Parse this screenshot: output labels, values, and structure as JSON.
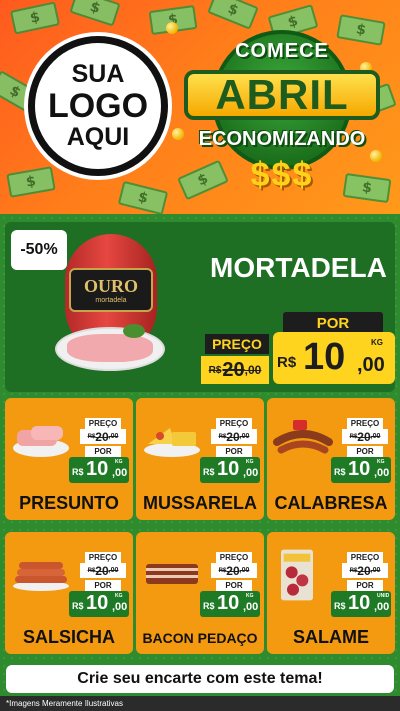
{
  "header": {
    "logo": {
      "line1": "SUA",
      "line2": "LOGO",
      "line3": "AQUI"
    },
    "badge": {
      "top": "COMECE",
      "main": "ABRIL",
      "bottom": "ECONOMIZANDO",
      "symbols": "$$$"
    }
  },
  "hero": {
    "discount": "-50%",
    "product": "MORTADELA",
    "brand": "OURO",
    "brand_sub": "mortadela",
    "preco_label": "PREÇO",
    "old_currency": "R$",
    "old_int": "20",
    "old_cents": ",00",
    "por_label": "POR",
    "new_currency": "R$",
    "new_int": "10",
    "new_cents": ",00",
    "unit": "KG"
  },
  "cards": [
    {
      "name": "PRESUNTO",
      "preco_label": "PREÇO",
      "old_currency": "R$",
      "old_int": "20",
      "old_cents": ",00",
      "por_label": "POR",
      "new_currency": "R$",
      "new_int": "10",
      "new_cents": ",00",
      "unit": "KG"
    },
    {
      "name": "MUSSARELA",
      "preco_label": "PREÇO",
      "old_currency": "R$",
      "old_int": "20",
      "old_cents": ",00",
      "por_label": "POR",
      "new_currency": "R$",
      "new_int": "10",
      "new_cents": ",00",
      "unit": "KG"
    },
    {
      "name": "CALABRESA",
      "preco_label": "PREÇO",
      "old_currency": "R$",
      "old_int": "20",
      "old_cents": ",00",
      "por_label": "POR",
      "new_currency": "R$",
      "new_int": "10",
      "new_cents": ",00",
      "unit": "KG"
    },
    {
      "name": "SALSICHA",
      "preco_label": "PREÇO",
      "old_currency": "R$",
      "old_int": "20",
      "old_cents": ",00",
      "por_label": "POR",
      "new_currency": "R$",
      "new_int": "10",
      "new_cents": ",00",
      "unit": "KG"
    },
    {
      "name": "BACON PEDAÇO",
      "preco_label": "PREÇO",
      "old_currency": "R$",
      "old_int": "20",
      "old_cents": ",00",
      "por_label": "POR",
      "new_currency": "R$",
      "new_int": "10",
      "new_cents": ",00",
      "unit": "KG"
    },
    {
      "name": "SALAME",
      "preco_label": "PREÇO",
      "old_currency": "R$",
      "old_int": "20",
      "old_cents": ",00",
      "por_label": "POR",
      "new_currency": "R$",
      "new_int": "10",
      "new_cents": ",00",
      "unit": "UNID"
    }
  ],
  "footer": {
    "cta": "Crie seu encarte com este tema!",
    "disclaimer": "*Imagens Meramente Ilustrativas"
  },
  "colors": {
    "header_orange": "#ff7e1a",
    "green_bg": "#2e8b2e",
    "hero_green": "#1e6f23",
    "card_orange": "#f39a10",
    "price_yellow": "#ffd41f",
    "price_green": "#1e7a25"
  }
}
